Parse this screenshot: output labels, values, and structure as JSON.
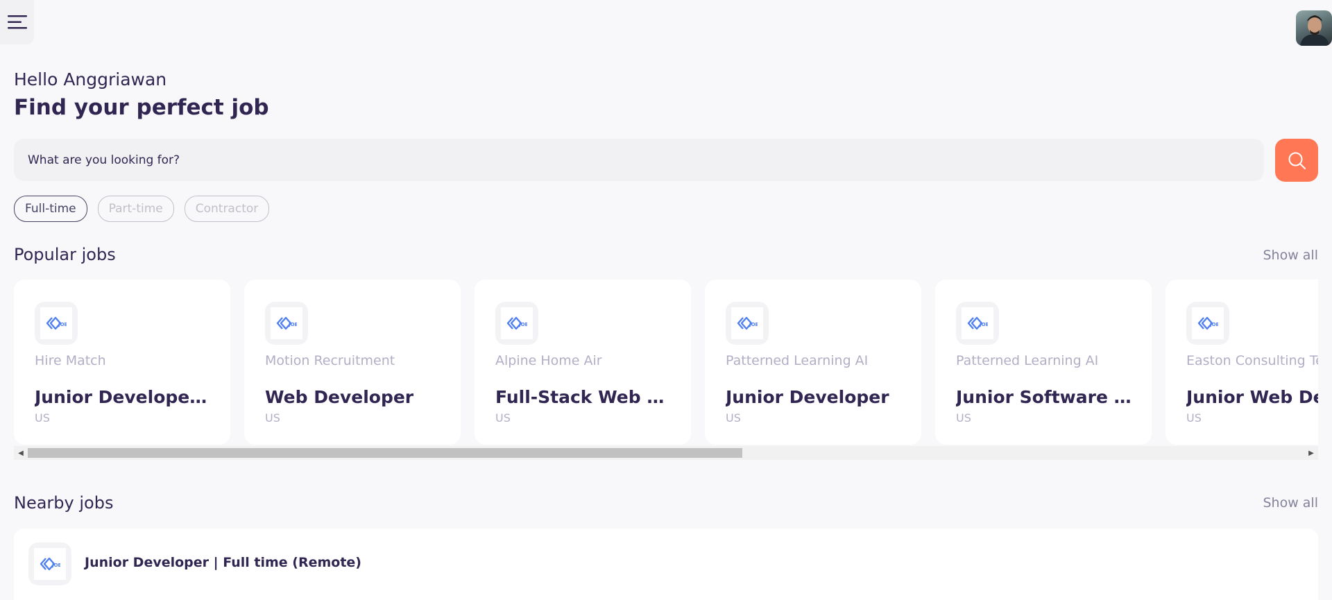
{
  "header": {
    "menu_icon": "hamburger-menu-icon",
    "avatar_icon": "user-avatar"
  },
  "welcome": {
    "greeting": "Hello Anggriawan",
    "headline": "Find your perfect job"
  },
  "search": {
    "placeholder": "What are you looking for?",
    "button_icon": "search-icon",
    "accent_color": "#ff7754"
  },
  "job_types": [
    {
      "label": "Full-time",
      "active": true
    },
    {
      "label": "Part-time",
      "active": false
    },
    {
      "label": "Contractor",
      "active": false
    }
  ],
  "popular": {
    "title": "Popular jobs",
    "show_all": "Show all",
    "jobs": [
      {
        "company": "Hire Match",
        "title": "Junior Developer | F...",
        "location": "US"
      },
      {
        "company": "Motion Recruitment",
        "title": "Web Developer",
        "location": "US"
      },
      {
        "company": "Alpine Home Air",
        "title": "Full-Stack Web Dev...",
        "location": "US"
      },
      {
        "company": "Patterned Learning AI",
        "title": "Junior Developer",
        "location": "US"
      },
      {
        "company": "Patterned Learning AI",
        "title": "Junior Software Eng...",
        "location": "US"
      },
      {
        "company": "Easton Consulting Te",
        "title": "Junior Web Deve",
        "location": "US"
      }
    ],
    "scroll_fraction": 0.56
  },
  "nearby": {
    "title": "Nearby jobs",
    "show_all": "Show all",
    "jobs": [
      {
        "title": "Junior Developer | Full time (Remote)"
      }
    ]
  }
}
